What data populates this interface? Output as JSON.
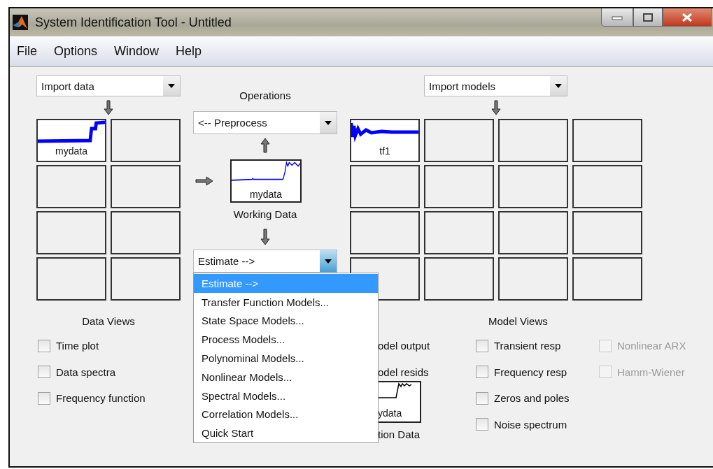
{
  "window": {
    "title": "System Identification Tool - Untitled"
  },
  "menu": [
    "File",
    "Options",
    "Window",
    "Help"
  ],
  "data_import": {
    "value": "Import data"
  },
  "data_boards": [
    {
      "kind": "step",
      "label": "mydata"
    },
    {
      "kind": "empty"
    },
    {
      "kind": "empty"
    },
    {
      "kind": "empty"
    },
    {
      "kind": "empty"
    },
    {
      "kind": "empty"
    },
    {
      "kind": "empty"
    },
    {
      "kind": "empty"
    }
  ],
  "operations": {
    "title": "Operations",
    "preprocess": "<-- Preprocess",
    "working_label": "mydata",
    "working_caption": "Working Data",
    "estimate": {
      "value": "Estimate -->",
      "expanded": true
    }
  },
  "estimate_menu": [
    {
      "label": "Estimate -->",
      "selected": true
    },
    {
      "label": "Transfer Function Models...",
      "selected": false
    },
    {
      "label": "State Space Models...",
      "selected": false
    },
    {
      "label": "Process Models...",
      "selected": false
    },
    {
      "label": "Polynominal Models...",
      "selected": false
    },
    {
      "label": "Nonlinear Models...",
      "selected": false
    },
    {
      "label": "Spectral Models...",
      "selected": false
    },
    {
      "label": "Correlation Models...",
      "selected": false
    },
    {
      "label": "Quick Start",
      "selected": false
    }
  ],
  "data_views": {
    "title": "Data Views",
    "options": [
      {
        "label": "Time plot",
        "checked": false
      },
      {
        "label": "Data spectra",
        "checked": false
      },
      {
        "label": "Frequency function",
        "checked": false
      }
    ]
  },
  "validation": {
    "options": [
      "odel output",
      "odel resids"
    ],
    "plot_label": "ydata",
    "caption": "tion Data"
  },
  "model_import": {
    "value": "Import models"
  },
  "model_boards": [
    {
      "kind": "decay",
      "label": "tf1"
    },
    {
      "kind": "empty"
    },
    {
      "kind": "empty"
    },
    {
      "kind": "empty"
    },
    {
      "kind": "empty"
    },
    {
      "kind": "empty"
    },
    {
      "kind": "empty"
    },
    {
      "kind": "empty"
    },
    {
      "kind": "empty"
    },
    {
      "kind": "empty"
    },
    {
      "kind": "empty"
    },
    {
      "kind": "empty"
    },
    {
      "kind": "empty"
    },
    {
      "kind": "empty"
    },
    {
      "kind": "empty"
    },
    {
      "kind": "empty"
    }
  ],
  "model_views": {
    "title": "Model Views",
    "columns": [
      [
        {
          "label": "Transient resp",
          "checked": false,
          "disabled": false
        },
        {
          "label": "Frequency resp",
          "checked": false,
          "disabled": false
        },
        {
          "label": "Zeros and poles",
          "checked": false,
          "disabled": false
        },
        {
          "label": "Noise spectrum",
          "checked": false,
          "disabled": false
        }
      ],
      [
        {
          "label": "Nonlinear ARX",
          "checked": false,
          "disabled": true
        },
        {
          "label": "Hamm-Wiener",
          "checked": false,
          "disabled": true
        }
      ]
    ]
  }
}
